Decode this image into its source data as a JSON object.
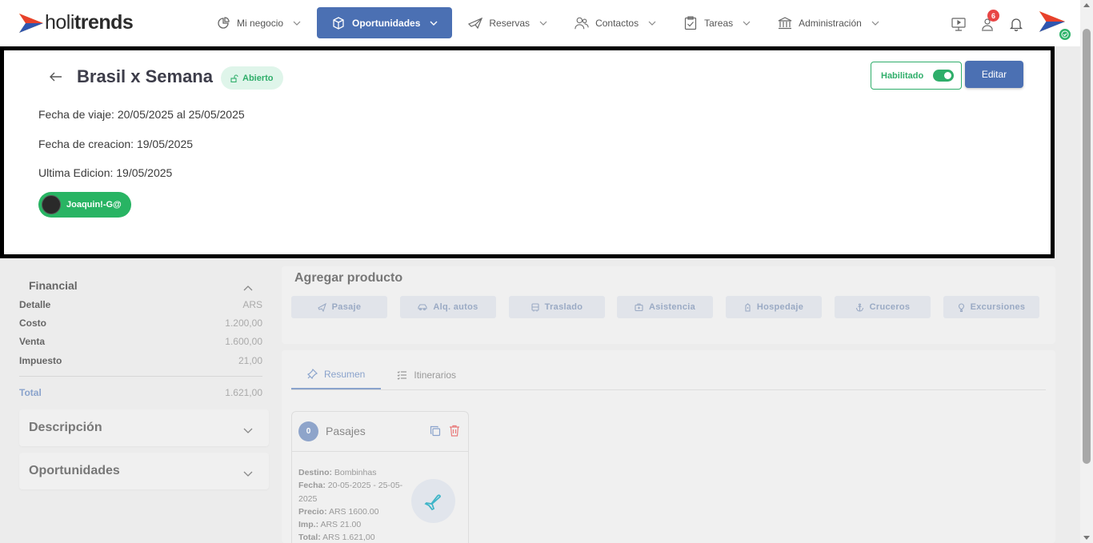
{
  "app": {
    "logo_text_light": "holi",
    "logo_text_bold": "trends"
  },
  "nav": {
    "items": [
      {
        "label": "Mi negocio",
        "icon": "pie-chart-icon"
      },
      {
        "label": "Oportunidades",
        "icon": "cube-icon",
        "active": true
      },
      {
        "label": "Reservas",
        "icon": "plane-icon"
      },
      {
        "label": "Contactos",
        "icon": "users-icon"
      },
      {
        "label": "Tareas",
        "icon": "clipboard-check-icon"
      },
      {
        "label": "Administración",
        "icon": "bank-icon"
      }
    ],
    "notification_count": "6"
  },
  "colors": {
    "primary": "#4b70b3",
    "success": "#2fae6a",
    "badge": "#e84545"
  },
  "header": {
    "title": "Brasil x Semana",
    "status": "Abierto",
    "travel_date": "Fecha de viaje: 20/05/2025 al 25/05/2025",
    "created_date": "Fecha de creacion: 19/05/2025",
    "last_edit": "Ultima Edicion: 19/05/2025",
    "user": "Joaquin!-G@",
    "enabled_label": "Habilitado",
    "enabled": true,
    "edit_label": "Editar"
  },
  "financial": {
    "title": "Financial",
    "rows": [
      {
        "label": "Detalle",
        "value": "ARS"
      },
      {
        "label": "Costo",
        "value": "1.200,00"
      },
      {
        "label": "Venta",
        "value": "1.600,00"
      },
      {
        "label": "Impuesto",
        "value": "21,00"
      }
    ],
    "total_label": "Total",
    "total_value": "1.621,00"
  },
  "sections": {
    "description": "Descripción",
    "opportunities": "Oportunidades"
  },
  "add_product": {
    "title": "Agregar producto",
    "buttons": [
      {
        "label": "Pasaje",
        "icon": "plane-icon"
      },
      {
        "label": "Alq. autos",
        "icon": "car-icon"
      },
      {
        "label": "Traslado",
        "icon": "bus-icon"
      },
      {
        "label": "Asistencia",
        "icon": "medkit-icon"
      },
      {
        "label": "Hospedaje",
        "icon": "hotel-icon"
      },
      {
        "label": "Cruceros",
        "icon": "anchor-icon"
      },
      {
        "label": "Excursiones",
        "icon": "balloon-icon"
      }
    ]
  },
  "tabs": [
    {
      "label": "Resumen",
      "icon": "pin-icon",
      "active": true
    },
    {
      "label": "Itinerarios",
      "icon": "list-icon"
    }
  ],
  "pasaje_card": {
    "count": "0",
    "title": "Pasajes",
    "destino_label": "Destino:",
    "destino": "Bombinhas",
    "fecha_label": "Fecha:",
    "fecha": "20-05-2025 - 25-05-2025",
    "precio_label": "Precio:",
    "precio": "ARS 1600.00",
    "imp_label": "Imp.:",
    "imp": "ARS 21.00",
    "total_label": "Total:",
    "total": "ARS 1.621,00"
  }
}
